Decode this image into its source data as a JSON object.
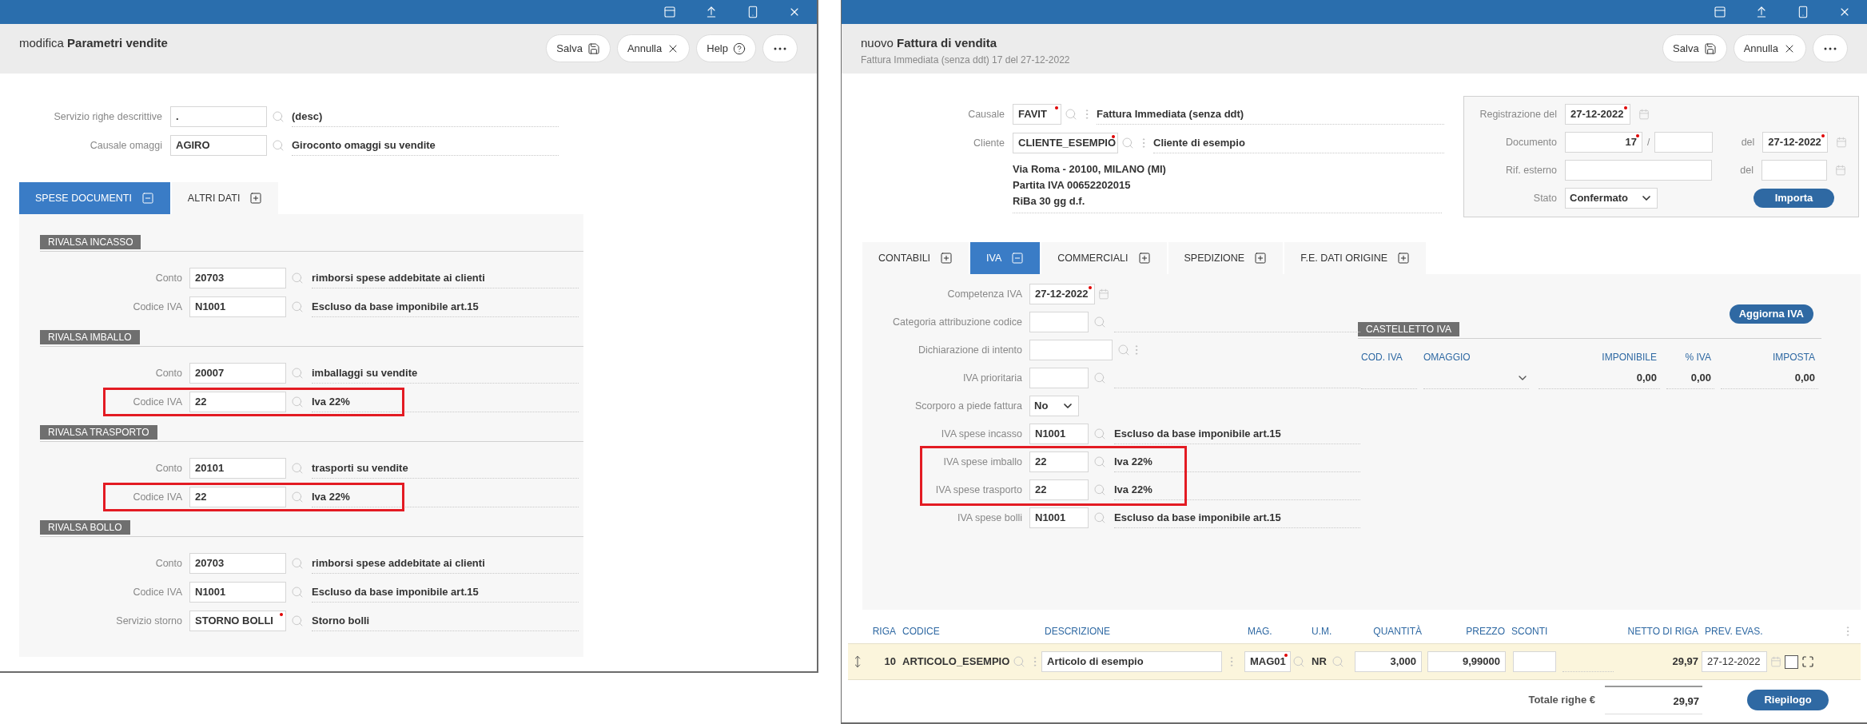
{
  "left_window": {
    "header": {
      "title": "modifica **Parametri vendite**",
      "buttons": [
        {
          "kind": "save",
          "label": "Salva"
        },
        {
          "kind": "cancel",
          "label": "Annulla"
        },
        {
          "kind": "help",
          "label": "Help"
        },
        {
          "kind": "more"
        }
      ]
    },
    "fields": [
      {
        "label": "Servizio righe descrittive",
        "value": ".",
        "description": "(desc)"
      },
      {
        "label": "Causale omaggi",
        "value": "AGIRO",
        "description": "Giroconto omaggi su vendite"
      }
    ],
    "tabs": [
      {
        "label": "SPESE DOCUMENTI",
        "selected": true
      },
      {
        "label": "ALTRI DATI",
        "selected": false
      }
    ],
    "sections": [
      {
        "title": "RIVALSA INCASSO",
        "rows": [
          {
            "label": "Conto",
            "value": "20703",
            "description": "rimborsi spese addebitate ai clienti",
            "required": false,
            "highlighted": false
          },
          {
            "label": "Codice IVA",
            "value": "N1001",
            "description": "Escluso da base imponibile art.15",
            "required": false,
            "highlighted": false
          }
        ]
      },
      {
        "title": "RIVALSA IMBALLO",
        "rows": [
          {
            "label": "Conto",
            "value": "20007",
            "description": "imballaggi su vendite",
            "required": false,
            "highlighted": false
          },
          {
            "label": "Codice IVA",
            "value": "22",
            "description": "Iva 22%",
            "required": false,
            "highlighted": true
          }
        ]
      },
      {
        "title": "RIVALSA TRASPORTO",
        "rows": [
          {
            "label": "Conto",
            "value": "20101",
            "description": "trasporti su vendite",
            "required": false,
            "highlighted": false
          },
          {
            "label": "Codice IVA",
            "value": "22",
            "description": "Iva 22%",
            "required": false,
            "highlighted": true
          }
        ]
      },
      {
        "title": "RIVALSA BOLLO",
        "rows": [
          {
            "label": "Conto",
            "value": "20703",
            "description": "rimborsi spese addebitate ai clienti",
            "required": false,
            "highlighted": false
          },
          {
            "label": "Codice IVA",
            "value": "N1001",
            "description": "Escluso da base imponibile art.15",
            "required": false,
            "highlighted": false
          },
          {
            "label": "Servizio storno",
            "value": "STORNO BOLLI",
            "description": "Storno bolli",
            "required": true,
            "highlighted": false
          }
        ]
      }
    ]
  },
  "right_window": {
    "header": {
      "title": "nuovo **Fattura di vendita**",
      "subtitle": "Fattura Immediata (senza ddt) 17 del 27-12-2022",
      "buttons": [
        {
          "kind": "save",
          "label": "Salva"
        },
        {
          "kind": "cancel",
          "label": "Annulla"
        },
        {
          "kind": "more"
        }
      ]
    },
    "document": {
      "fields": [
        {
          "label": "Causale",
          "value": "FAVIT",
          "required": true,
          "description": "Fattura Immediata (senza ddt)"
        },
        {
          "label": "Cliente",
          "value": "CLIENTE_ESEMPIO",
          "required": true,
          "description": "Cliente di esempio"
        }
      ],
      "address_lines": [
        "Via Roma - 20100, MILANO (MI)",
        "Partita IVA 00652202015",
        "RiBa 30 gg d.f."
      ]
    },
    "registration": {
      "registrazione": {
        "label": "Registrazione del",
        "value": "27-12-2022",
        "required": true
      },
      "documento": {
        "label": "Documento",
        "number": "17",
        "number_required": true,
        "separator": "/",
        "date_label": "del",
        "date": "27-12-2022",
        "date_required": true
      },
      "rif_esterno": {
        "label": "Rif. esterno",
        "date_label": "del"
      },
      "stato": {
        "label": "Stato",
        "value": "Confermato"
      },
      "import_button": "Importa"
    },
    "tabs": [
      {
        "label": "CONTABILI",
        "selected": false
      },
      {
        "label": "IVA",
        "selected": true
      },
      {
        "label": "COMMERCIALI",
        "selected": false
      },
      {
        "label": "SPEDIZIONE",
        "selected": false
      },
      {
        "label": "F.E. DATI ORIGINE",
        "selected": false
      }
    ],
    "iva_fields": [
      {
        "kind": "date",
        "label": "Competenza IVA",
        "value": "27-12-2022",
        "required": true,
        "highlighted": false
      },
      {
        "kind": "lookup",
        "label": "Categoria attribuzione codice",
        "required": false,
        "highlighted": false
      },
      {
        "kind": "lookup_menu",
        "label": "Dichiarazione di intento",
        "required": false,
        "highlighted": false
      },
      {
        "kind": "lookup",
        "label": "IVA prioritaria",
        "required": false,
        "highlighted": false
      },
      {
        "kind": "select",
        "label": "Scorporo a piede fattura",
        "value": "No",
        "required": false,
        "highlighted": false
      },
      {
        "kind": "lookup",
        "label": "IVA spese incasso",
        "value": "N1001",
        "description": "Escluso da base imponibile art.15",
        "required": false,
        "highlighted": false
      },
      {
        "kind": "lookup",
        "label": "IVA spese imballo",
        "value": "22",
        "description": "Iva 22%",
        "required": false,
        "highlighted": true
      },
      {
        "kind": "lookup",
        "label": "IVA spese trasporto",
        "value": "22",
        "description": "Iva 22%",
        "required": false,
        "highlighted": true
      },
      {
        "kind": "lookup",
        "label": "IVA spese bolli",
        "value": "N1001",
        "description": "Escluso da base imponibile art.15",
        "required": false,
        "highlighted": false
      }
    ],
    "castelletto": {
      "title": "CASTELLETTO IVA",
      "button": "Aggiorna IVA",
      "columns": [
        "COD. IVA",
        "OMAGGIO",
        "IMPONIBILE",
        "% IVA",
        "IMPOSTA"
      ],
      "rows": [
        {
          "imponibile": "0,00",
          "percent": "0,00",
          "imposta": "0,00"
        }
      ]
    },
    "lines": {
      "columns": [
        "RIGA",
        "CODICE",
        "DESCRIZIONE",
        "MAG.",
        "U.M.",
        "QUANTITÀ",
        "PREZZO",
        "SCONTI",
        "NETTO DI RIGA",
        "PREV. EVAS."
      ],
      "rows": [
        {
          "riga": "10",
          "codice": "ARTICOLO_ESEMPIO",
          "descrizione": "Articolo di esempio",
          "mag": "MAG01",
          "mag_required": true,
          "um": "NR",
          "quantita": "3,000",
          "prezzo": "9,99000",
          "netto": "29,97",
          "prev_evas": "27-12-2022",
          "checked": false
        }
      ]
    },
    "totals": {
      "label": "Totale righe €",
      "value": "29,97",
      "button": "Riepilogo"
    }
  }
}
